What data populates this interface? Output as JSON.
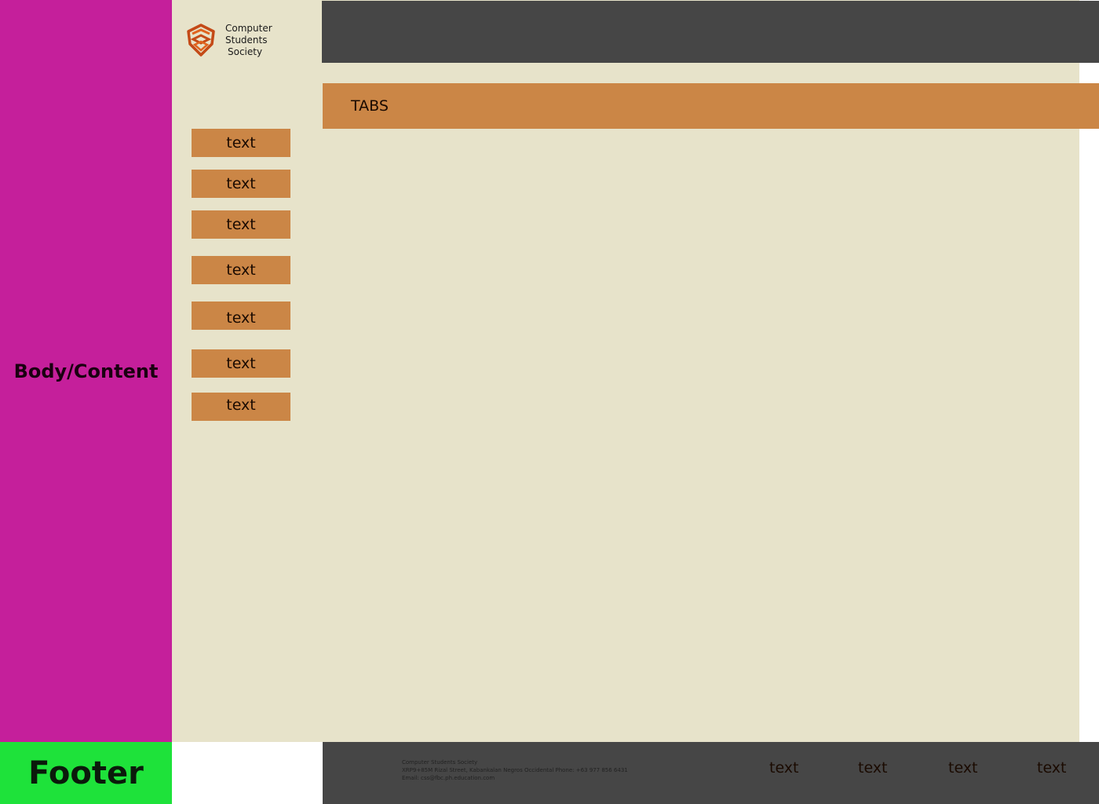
{
  "annotations": {
    "body_label": "Body/Content",
    "footer_label": "Footer"
  },
  "brand": {
    "line1": "Computer",
    "line2": "Students",
    "line3": "Society",
    "logo_icon": "shield-logo-icon"
  },
  "tabs": {
    "label": "TABS"
  },
  "sidebar": {
    "items": [
      {
        "label": "text"
      },
      {
        "label": "text"
      },
      {
        "label": "text"
      },
      {
        "label": "text"
      },
      {
        "label": "text"
      },
      {
        "label": "text"
      },
      {
        "label": "text"
      }
    ]
  },
  "footer": {
    "org": "Computer Students Society",
    "address": "XRP9+85M Rizal Street, Kabankalan Negros Occidental Phone: +63 977 856 6431",
    "email": "Email: css@fbc.ph.education.com",
    "links": [
      {
        "label": "text"
      },
      {
        "label": "text"
      },
      {
        "label": "text"
      },
      {
        "label": "text"
      }
    ]
  },
  "colors": {
    "body_label_bg": "#c51f9b",
    "footer_label_bg": "#1ee23a",
    "cream": "#e7e3ca",
    "dark": "#464646",
    "accent": "#cb8646"
  }
}
